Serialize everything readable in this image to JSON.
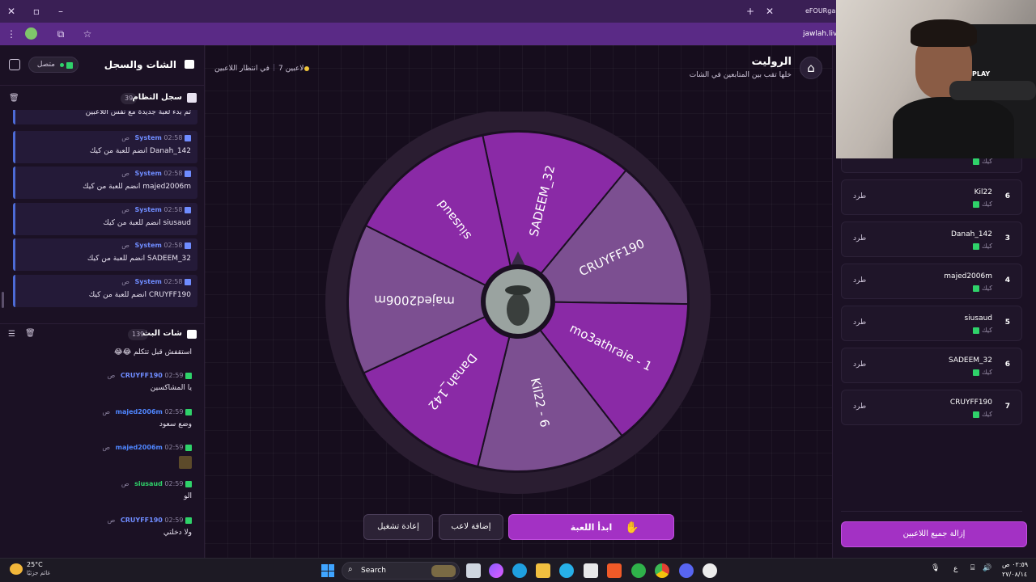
{
  "browser": {
    "tab_title": "eFOURgam",
    "url": "jawlah.live"
  },
  "left_panel": {
    "title": "الشات والسجل",
    "status": "متصل",
    "system_log": {
      "title": "سجل النظام",
      "count": "39",
      "top_partial": "تم بدء لعبة جديدة مع نفس اللاعبين",
      "items": [
        {
          "sender": "System",
          "time": "02:58 ص",
          "message": "Danah_142 انضم للعبة من كيك"
        },
        {
          "sender": "System",
          "time": "02:58 ص",
          "message": "majed2006m انضم للعبة من كيك"
        },
        {
          "sender": "System",
          "time": "02:58 ص",
          "message": "siusaud انضم للعبة من كيك"
        },
        {
          "sender": "System",
          "time": "02:58 ص",
          "message": "SADEEM_32 انضم للعبة من كيك"
        },
        {
          "sender": "System",
          "time": "02:58 ص",
          "message": "CRUYFF190 انضم للعبة من كيك"
        }
      ]
    },
    "stream_chat": {
      "title": "شات البث",
      "count": "139",
      "top_partial": "استقفش قبل تتكلم 😂😂",
      "items": [
        {
          "user": "CRUYFF190",
          "time": "02:59 ص",
          "message": "يا المشاكسين",
          "color": "#6f8cff"
        },
        {
          "user": "majed2006m",
          "time": "02:59 ص",
          "message": "وضع سعود",
          "color": "#4f86ff"
        },
        {
          "user": "majed2006m",
          "time": "02:59 ص",
          "message": "",
          "color": "#4f86ff"
        },
        {
          "user": "siusaud",
          "time": "02:59 ص",
          "message": "الو",
          "color": "#2fd26a"
        },
        {
          "user": "CRUYFF190",
          "time": "02:59 ص",
          "message": "ولا دخلتي",
          "color": "#6f8cff"
        }
      ]
    }
  },
  "header": {
    "title": "الروليت",
    "subtitle": "خلها تقب بين المتابعين في الشات",
    "players_count": "7 لاعبين",
    "waiting": "في انتظار اللاعبين"
  },
  "wheel": {
    "segments": [
      "SADEEM_32",
      "CRUYFF190",
      "mo3athraie - 1",
      "Kil22 - 6",
      "Danah_142",
      "majed2006m",
      "siusaud"
    ]
  },
  "buttons": {
    "start": "ابدأ اللعبة",
    "add_player": "إضافة لاعب",
    "restart": "إعادة تشغيل",
    "remove_all": "إزالة جميع اللاعبين"
  },
  "players": {
    "top_partial_sub": "كيك",
    "kick_label": "طرد",
    "list": [
      {
        "num": "6",
        "name": "Kil22",
        "source": "كيك"
      },
      {
        "num": "3",
        "name": "Danah_142",
        "source": "كيك"
      },
      {
        "num": "4",
        "name": "majed2006m",
        "source": "كيك"
      },
      {
        "num": "5",
        "name": "siusaud",
        "source": "كيك"
      },
      {
        "num": "6",
        "name": "SADEEM_32",
        "source": "كيك"
      },
      {
        "num": "7",
        "name": "CRUYFF190",
        "source": "كيك"
      }
    ]
  },
  "taskbar": {
    "weather_temp": "25°C",
    "weather_desc": "غائم جزئيًا",
    "search": "Search",
    "clock_time": "٠٢:٥٩ ص",
    "clock_date": "٢٧/٠٨/١٤",
    "lang": "ع"
  },
  "webcam": {
    "label": "PLAY"
  }
}
